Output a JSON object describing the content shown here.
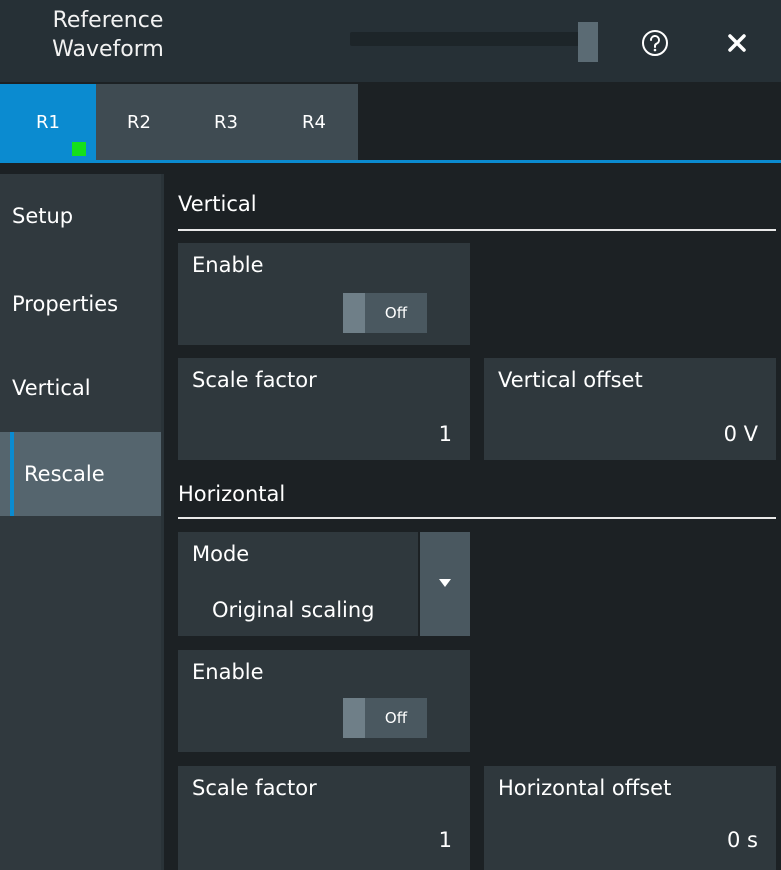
{
  "header": {
    "title_line1": "Reference",
    "title_line2": "Waveform",
    "help_icon": "help-circle-icon",
    "close_icon": "close-x-icon"
  },
  "tabs": [
    {
      "label": "R1",
      "active": true
    },
    {
      "label": "R2",
      "active": false
    },
    {
      "label": "R3",
      "active": false
    },
    {
      "label": "R4",
      "active": false
    }
  ],
  "sidebar": {
    "items": [
      {
        "label": "Setup"
      },
      {
        "label": "Properties"
      },
      {
        "label": "Vertical"
      },
      {
        "label": "Rescale",
        "active": true
      }
    ]
  },
  "vertical": {
    "title": "Vertical",
    "enable_label": "Enable",
    "enable_value": "Off",
    "scale_label": "Scale factor",
    "scale_value": "1",
    "offset_label": "Vertical offset",
    "offset_value": "0 V"
  },
  "horizontal": {
    "title": "Horizontal",
    "mode_label": "Mode",
    "mode_value": "Original scaling",
    "enable_label": "Enable",
    "enable_value": "Off",
    "scale_label": "Scale factor",
    "scale_value": "1",
    "offset_label": "Horizontal offset",
    "offset_value": "0 s"
  },
  "colors": {
    "accent": "#0b8bd0",
    "indicator": "#15e01b",
    "panel": "#2f383d",
    "background": "#1c2124"
  }
}
